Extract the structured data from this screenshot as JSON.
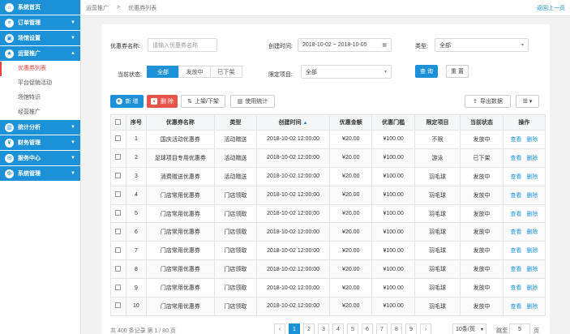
{
  "sidebar": {
    "items": [
      {
        "label": "系统首页",
        "icon": "home-icon",
        "glyph": "⌂"
      },
      {
        "label": "订单管理",
        "icon": "order-icon",
        "glyph": "≡"
      },
      {
        "label": "场馆设置",
        "icon": "venue-icon",
        "glyph": "▣"
      },
      {
        "label": "运营推广",
        "icon": "promo-icon",
        "glyph": "★"
      }
    ],
    "subitems": [
      {
        "label": "优惠券列表"
      },
      {
        "label": "平台促销活动"
      },
      {
        "label": "场馆特识"
      },
      {
        "label": "经营推广"
      }
    ],
    "items2": [
      {
        "label": "统计分析",
        "icon": "chart-icon",
        "glyph": "▥"
      },
      {
        "label": "财务管理",
        "icon": "finance-icon",
        "glyph": "¥"
      },
      {
        "label": "服务中心",
        "icon": "service-icon",
        "glyph": "✉"
      },
      {
        "label": "系统管理",
        "icon": "settings-icon",
        "glyph": "⚙"
      }
    ]
  },
  "header": {
    "crumb1": "运营推广",
    "sep": ">",
    "crumb2": "优惠券列表",
    "back": "返回上一页"
  },
  "filters": {
    "name_label": "优惠券名称:",
    "name_placeholder": "请输入优惠券名称",
    "created_label": "创建时间:",
    "created_value": "2018-10-02  ~  2018-10-05",
    "type_label": "类型:",
    "type_value": "全部",
    "status_label": "当前状态:",
    "status_options": [
      "全部",
      "发放中",
      "已下架"
    ],
    "limit_label": "限定项目:",
    "limit_value": "全部",
    "query": "查 询",
    "reset": "重 置"
  },
  "toolbar": {
    "add": "新 增",
    "delete": "删 除",
    "onoff": "上架/下架",
    "stats": "使用统计",
    "export": "导出数据"
  },
  "table": {
    "headers": [
      "",
      "序号",
      "优惠券名称",
      "类型",
      "创建时间",
      "优惠金额",
      "优惠门槛",
      "限定项目",
      "当前状态",
      "操作"
    ],
    "view": "查看",
    "del": "删除",
    "rows": [
      [
        "1",
        "国庆活动优惠券",
        "活动赠送",
        "2018-10-02  12:00:00",
        "¥20.00",
        "¥100.00",
        "不限",
        "发放中"
      ],
      [
        "2",
        "足球项目专用优惠券",
        "活动赠送",
        "2018-10-02  12:00:00",
        "¥20.00",
        "¥100.00",
        "游泳",
        "已下架"
      ],
      [
        "3",
        "消费赠送优惠券",
        "活动赠送",
        "2018-10-02  12:00:00",
        "¥20.00",
        "¥100.00",
        "羽毛球",
        "发放中"
      ],
      [
        "4",
        "门店常用优惠券",
        "门店领取",
        "2018-10-02  12:00:00",
        "¥20.00",
        "¥100.00",
        "羽毛球",
        "发放中"
      ],
      [
        "5",
        "门店常用优惠券",
        "门店领取",
        "2018-10-02  12:00:00",
        "¥20.00",
        "¥100.00",
        "羽毛球",
        "发放中"
      ],
      [
        "6",
        "门店常用优惠券",
        "门店领取",
        "2018-10-02  12:00:00",
        "¥20.00",
        "¥100.00",
        "羽毛球",
        "发放中"
      ],
      [
        "7",
        "门店常用优惠券",
        "门店领取",
        "2018-10-02  12:00:00",
        "¥20.00",
        "¥100.00",
        "羽毛球",
        "发放中"
      ],
      [
        "8",
        "门店常用优惠券",
        "门店领取",
        "2018-10-02  12:00:00",
        "¥20.00",
        "¥100.00",
        "羽毛球",
        "发放中"
      ],
      [
        "9",
        "门店常用优惠券",
        "门店领取",
        "2018-10-02  12:00:00",
        "¥20.00",
        "¥100.00",
        "羽毛球",
        "发放中"
      ],
      [
        "10",
        "门店常用优惠券",
        "门店领取",
        "2018-10-02  12:00:00",
        "¥20.00",
        "¥100.00",
        "羽毛球",
        "发放中"
      ]
    ]
  },
  "footer": {
    "info": "共 400 条记录 第 1 / 80 页",
    "pages": [
      "‹",
      "1",
      "2",
      "3",
      "4",
      "5",
      "6",
      "7",
      "8",
      "9",
      "›"
    ],
    "page_size": "10条/页",
    "jump_label": "跳至",
    "jump_value": "5",
    "jump_unit": "页"
  }
}
